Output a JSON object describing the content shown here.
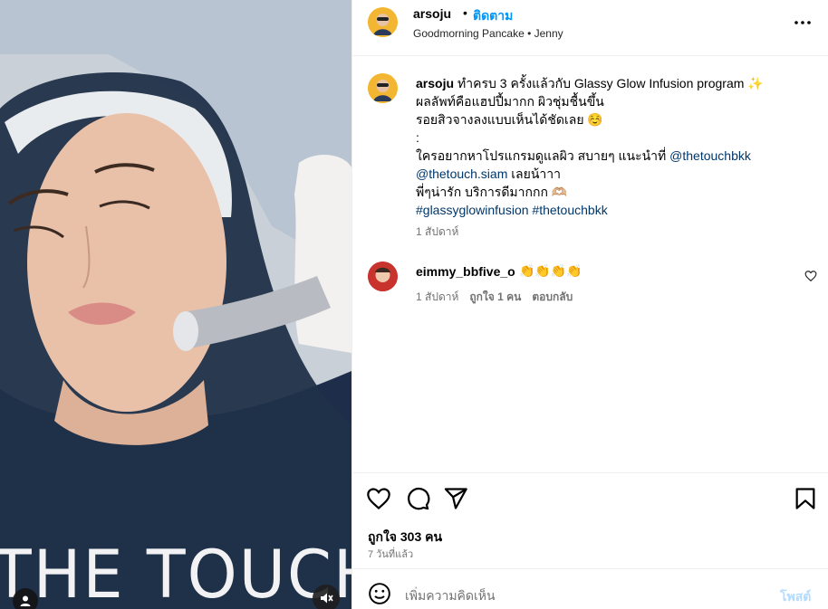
{
  "media": {
    "shirt_text": "THE TOUCH",
    "icons": {
      "user_tag": "user-icon",
      "mute": "speaker-muted-icon"
    }
  },
  "header": {
    "username": "arsoju",
    "separator": "•",
    "follow_label": "ติดตาม",
    "audio": "Goodmorning Pancake • Jenny",
    "more_icon": "more-horizontal-icon"
  },
  "caption": {
    "username": "arsoju",
    "line1": "ทำครบ 3 ครั้งแล้วกับ Glassy Glow Infusion program ✨",
    "line2": "ผลลัพท์คือแฮปปี้มากก ผิวชุ่มชื้นขึ้น",
    "line3": "รอยสิวจางลงแบบเห็นได้ชัดเลย ☺️",
    "line4": ":",
    "line5": "ใครอยากหาโปรแกรมดูแลผิว สบายๆ แนะนำที่",
    "mention1": "@thetouchbkk",
    "mention2": "@thetouch.siam",
    "line6_suffix": "เลยน้าาา",
    "line7": "พี่ๆน่ารัก บริการดีมากกก 🫶🏼",
    "hashtag1": "#glassyglowinfusion",
    "hashtag2": "#thetouchbkk",
    "time": "1 สัปดาห์"
  },
  "comment": {
    "username": "eimmy_bbfive_o",
    "text": "👏👏👏👏",
    "time": "1 สัปดาห์",
    "likes": "ถูกใจ 1 คน",
    "reply": "ตอบกลับ",
    "heart_icon": "heart-outline-icon"
  },
  "actions": {
    "icons": [
      "heart-icon",
      "comment-icon",
      "share-icon",
      "bookmark-icon"
    ],
    "likes": "ถูกใจ 303 คน",
    "posted": "7 วันที่แล้ว"
  },
  "add_comment": {
    "placeholder": "เพิ่มความคิดเห็น",
    "post_label": "โพสต์",
    "emoji_icon": "emoji-icon"
  }
}
